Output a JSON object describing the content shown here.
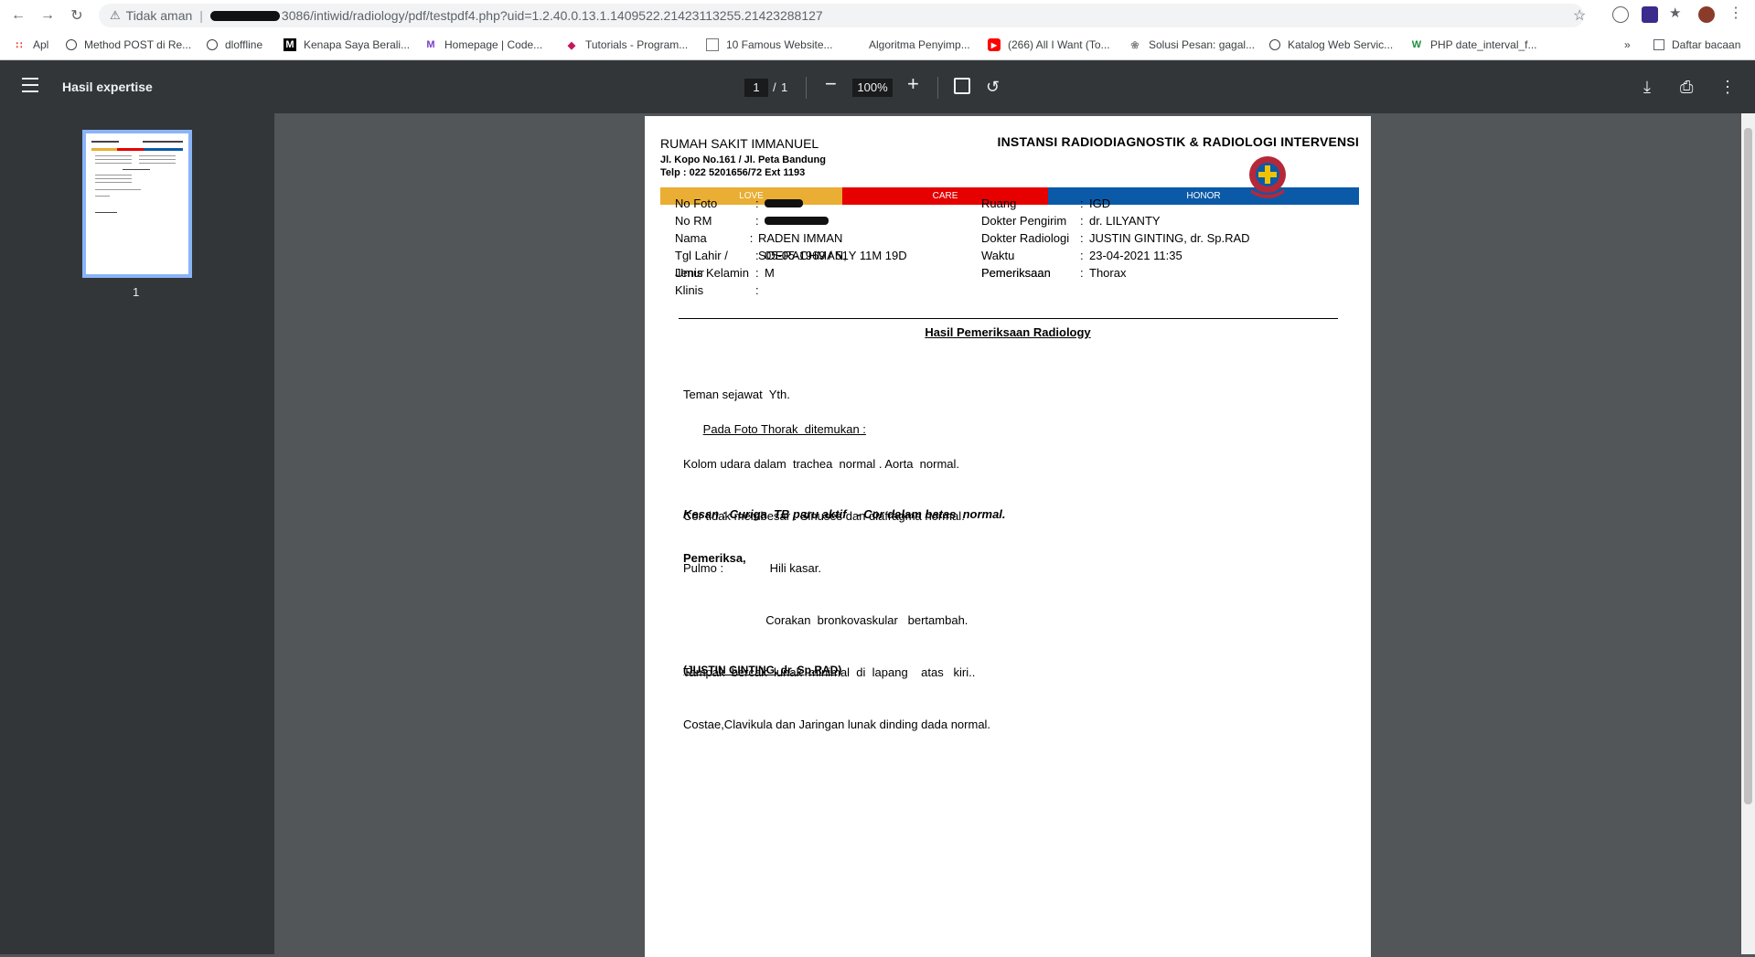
{
  "browser": {
    "security_label": "Tidak aman",
    "url_text": "3086/intiwid/radiology/pdf/testpdf4.php?uid=1.2.40.0.13.1.1409522.21423113255.21423288127"
  },
  "bookmarks": {
    "items": [
      {
        "label": "Apl"
      },
      {
        "label": "Method POST di Re..."
      },
      {
        "label": "dloffline"
      },
      {
        "label": "Kenapa Saya Berali..."
      },
      {
        "label": "Homepage | Code..."
      },
      {
        "label": "Tutorials - Program..."
      },
      {
        "label": "10 Famous Website..."
      },
      {
        "label": "Algoritma Penyimp..."
      },
      {
        "label": "(266) All I Want (To..."
      },
      {
        "label": "Solusi Pesan: gagal..."
      },
      {
        "label": "Katalog Web Servic..."
      },
      {
        "label": "PHP date_interval_f..."
      }
    ],
    "more": "»",
    "reading_list": "Daftar bacaan"
  },
  "pdf": {
    "title": "Hasil expertise",
    "current_page": "1",
    "page_sep": "/",
    "total_pages": "1",
    "zoom": "100%",
    "thumb_label": "1"
  },
  "document": {
    "hospital_name": "RUMAH SAKIT IMMANUEL",
    "address": "Jl. Kopo No.161 / Jl. Peta Bandung",
    "phone": "Telp : 022 5201656/72 Ext 1193",
    "institution": "INSTANSI RADIODIAGNOSTIK & RADIOLOGI INTERVENSI",
    "bands": [
      "LOVE",
      "CARE",
      "HONOR"
    ],
    "band_colors": [
      "#e9ae33",
      "#e60000",
      "#0b5aa8"
    ],
    "left_fields": [
      {
        "label": "No Foto",
        "sep": ":",
        "value": ""
      },
      {
        "label": "No RM",
        "sep": ":",
        "value": ""
      },
      {
        "label": "Nama",
        "sep": ":",
        "value": "RADEN IMMAN SOERACHMAN,"
      },
      {
        "label": "Tgl Lahir / Umur",
        "sep": ":",
        "value": "05-05-1969 / 51Y 11M 19D"
      },
      {
        "label": "Jenis Kelamin",
        "sep": ":",
        "value": "M"
      },
      {
        "label": "Klinis",
        "sep": ":",
        "value": ""
      }
    ],
    "right_fields": [
      {
        "label": "Ruang",
        "sep": ":",
        "value": "IGD"
      },
      {
        "label": "Dokter Pengirim",
        "sep": ":",
        "value": "dr. LILYANTY"
      },
      {
        "label": "Dokter Radiologi",
        "sep": ":",
        "value": "JUSTIN GINTING, dr. Sp.RAD"
      },
      {
        "label": "Waktu Pemeriksaan",
        "sep": ":",
        "value": "23-04-2021 11:35"
      },
      {
        "label": "Pemeriksaan",
        "sep": ":",
        "value": "Thorax"
      }
    ],
    "result_title": "Hasil Pemeriksaan Radiology",
    "greeting": "Teman sejawat  Yth.",
    "finding_heading": "Pada Foto Thorak  ditemukan :",
    "lines": [
      "Kolom udara dalam  trachea  normal . Aorta  normal.",
      "Cor tidak membesar . Sinuses dan diafragma normal.",
      "Pulmo :              Hili kasar.",
      "                         Corakan  bronkovaskular   bertambah.",
      "Tampak  bercak  lunak  minimal  di  lapang    atas   kiri..",
      "Costae,Clavikula dan Jaringan lunak dinding dada normal."
    ],
    "kesan": "Kesan : Curiga  TB paru aktif   - Cor dalam batas  normal.",
    "examiner_label": "Pemeriksa,",
    "signer": "(JUSTIN GINTING, dr. Sp.RAD)"
  }
}
